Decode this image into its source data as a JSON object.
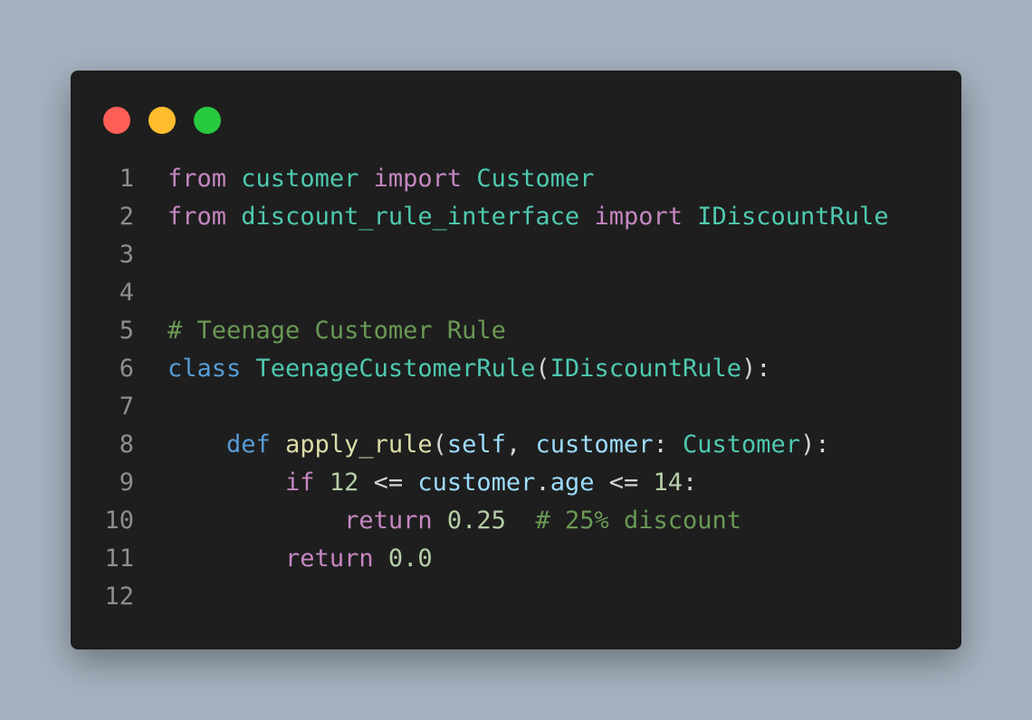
{
  "window": {
    "controls": [
      "close",
      "minimize",
      "maximize"
    ],
    "colors": {
      "background": "#1e1e1e",
      "close": "#ff5f56",
      "minimize": "#ffbd2e",
      "maximize": "#27c93f"
    }
  },
  "code": {
    "line_numbers": [
      "1",
      "2",
      "3",
      "4",
      "5",
      "6",
      "7",
      "8",
      "9",
      "10",
      "11",
      "12"
    ],
    "lines": [
      [
        {
          "t": "from",
          "c": "kw"
        },
        {
          "t": " ",
          "c": "pun"
        },
        {
          "t": "customer",
          "c": "mod"
        },
        {
          "t": " ",
          "c": "pun"
        },
        {
          "t": "import",
          "c": "kw"
        },
        {
          "t": " ",
          "c": "pun"
        },
        {
          "t": "Customer",
          "c": "cls"
        }
      ],
      [
        {
          "t": "from",
          "c": "kw"
        },
        {
          "t": " ",
          "c": "pun"
        },
        {
          "t": "discount_rule_interface",
          "c": "mod"
        },
        {
          "t": " ",
          "c": "pun"
        },
        {
          "t": "import",
          "c": "kw"
        },
        {
          "t": " ",
          "c": "pun"
        },
        {
          "t": "IDiscountRule",
          "c": "cls"
        }
      ],
      [],
      [],
      [
        {
          "t": "# Teenage Customer Rule",
          "c": "com"
        }
      ],
      [
        {
          "t": "class",
          "c": "kw2"
        },
        {
          "t": " ",
          "c": "pun"
        },
        {
          "t": "TeenageCustomerRule",
          "c": "cls"
        },
        {
          "t": "(",
          "c": "pun"
        },
        {
          "t": "IDiscountRule",
          "c": "cls"
        },
        {
          "t": "):",
          "c": "pun"
        }
      ],
      [],
      [
        {
          "t": "    ",
          "c": "pun"
        },
        {
          "t": "def",
          "c": "kw2"
        },
        {
          "t": " ",
          "c": "pun"
        },
        {
          "t": "apply_rule",
          "c": "fn"
        },
        {
          "t": "(",
          "c": "pun"
        },
        {
          "t": "self",
          "c": "var"
        },
        {
          "t": ", ",
          "c": "pun"
        },
        {
          "t": "customer",
          "c": "var"
        },
        {
          "t": ": ",
          "c": "pun"
        },
        {
          "t": "Customer",
          "c": "cls"
        },
        {
          "t": "):",
          "c": "pun"
        }
      ],
      [
        {
          "t": "        ",
          "c": "pun"
        },
        {
          "t": "if",
          "c": "kw"
        },
        {
          "t": " ",
          "c": "pun"
        },
        {
          "t": "12",
          "c": "num"
        },
        {
          "t": " <= ",
          "c": "pun"
        },
        {
          "t": "customer",
          "c": "var"
        },
        {
          "t": ".",
          "c": "pun"
        },
        {
          "t": "age",
          "c": "var"
        },
        {
          "t": " <= ",
          "c": "pun"
        },
        {
          "t": "14",
          "c": "num"
        },
        {
          "t": ":",
          "c": "pun"
        }
      ],
      [
        {
          "t": "            ",
          "c": "pun"
        },
        {
          "t": "return",
          "c": "kw"
        },
        {
          "t": " ",
          "c": "pun"
        },
        {
          "t": "0.25",
          "c": "num"
        },
        {
          "t": "  ",
          "c": "pun"
        },
        {
          "t": "# 25% discount",
          "c": "com"
        }
      ],
      [
        {
          "t": "        ",
          "c": "pun"
        },
        {
          "t": "return",
          "c": "kw"
        },
        {
          "t": " ",
          "c": "pun"
        },
        {
          "t": "0.0",
          "c": "num"
        }
      ],
      []
    ]
  }
}
